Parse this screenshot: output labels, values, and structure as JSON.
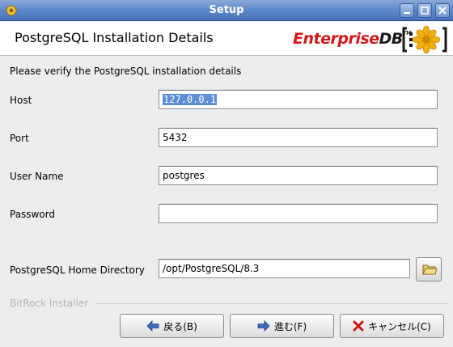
{
  "window": {
    "title": "Setup"
  },
  "header": {
    "title": "PostgreSQL Installation Details",
    "logo_main": "Enterprise",
    "logo_db": "DB",
    "logo_tm": "TM"
  },
  "form": {
    "instruction": "Please verify the PostgreSQL installation details",
    "host_label": "Host",
    "host_value": "127.0.0.1",
    "port_label": "Port",
    "port_value": "5432",
    "user_label": "User Name",
    "user_value": "postgres",
    "password_label": "Password",
    "password_value": "",
    "home_label": "PostgreSQL Home Directory",
    "home_value": "/opt/PostgreSQL/8.3"
  },
  "footer": {
    "brand": "BitRock Installer",
    "back_label": "戻る(B)",
    "next_label": "進む(F)",
    "cancel_label": "キャンセル(C)"
  },
  "colors": {
    "titlebar": "#5a84c8",
    "selection": "#5f8ed8",
    "logo_red": "#d01818"
  },
  "icons": [
    "app-icon",
    "minimize-icon",
    "maximize-icon",
    "close-icon",
    "logo-flower-icon",
    "folder-icon",
    "arrow-left-icon",
    "arrow-right-icon",
    "cancel-x-icon"
  ]
}
